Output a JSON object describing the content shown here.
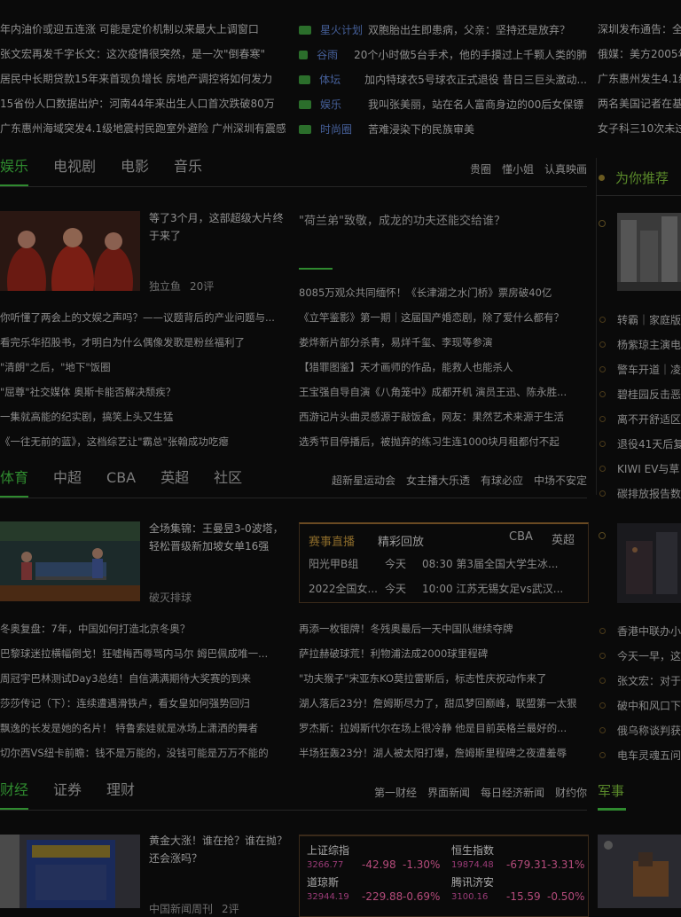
{
  "top_left_news": [
    "年内油价或迎五连涨 可能是定价机制以来最大上调窗口",
    "张文宏再发千字长文：这次疫情很突然，是一次\"倒春寒\"",
    "居民中长期贷款15年来首现负增长 房地产调控将如何发力",
    "15省份人口数据出炉：河南44年来出生人口首次跌破80万",
    "广东惠州海域突发4.1级地震村民跑室外避险 广州深圳有震感"
  ],
  "top_mid_news": [
    {
      "cat": "星火计划",
      "text": "双胞胎出生即患病，父亲：坚持还是放弃？"
    },
    {
      "cat": "谷雨",
      "text": "20个小时做5台手术，他的手摸过上千颗人类的肺"
    },
    {
      "cat": "体坛",
      "text": "加内特球衣5号球衣正式退役 昔日三巨头激动..."
    },
    {
      "cat": "娱乐",
      "text": "我叫张美丽，站在名人富商身边的00后女保镖"
    },
    {
      "cat": "时尚圈",
      "text": "苦难浸染下的民族审美"
    }
  ],
  "top_right_news": [
    "深圳发布通告：全",
    "俄媒：美方2005年",
    "广东惠州发生4.1级",
    "两名美国记者在基",
    "女子科三10次未过"
  ],
  "ent": {
    "tabs": [
      "娱乐",
      "电视剧",
      "电影",
      "音乐"
    ],
    "links": [
      "贵圈",
      "懂小姐",
      "认真映画"
    ],
    "feature_caption": "等了3个月，这部超级大片终于来了",
    "feature_source": "独立鱼",
    "feature_comments": "20评",
    "headline": "\"荷兰弟\"致敬，成龙的功夫还能交给谁？",
    "left_list": [
      "你听懂了两会上的文娱之声吗？——议题背后的产业问题与...",
      "看完乐华招股书，才明白为什么偶像发歌是粉丝福利了",
      "\"清朗\"之后，\"地下\"饭圈",
      "\"屈尊\"社交媒体 奥斯卡能否解决颓疾？",
      "一集就高能的纪实剧，搞笑上头又生猛",
      "《一往无前的蓝》，这档综艺让\"霸总\"张翰成功吃瘪"
    ],
    "right_list": [
      "8085万观众共同缅怀！《长津湖之水门桥》票房破40亿",
      "《立竿鉴影》第一期｜这届国产婚恋剧，除了爱什么都有？",
      "娄烨新片部分杀青，易烊千玺、李现等参演",
      "【猎罪图鉴】天才画师的作品，能救人也能杀人",
      "王宝强自导自演《八角笼中》成都开机 演员王迅、陈永胜...",
      "西游记片头曲灵感源于敲饭盒，网友：果然艺术来源于生活",
      "选秀节目停播后，被抛弃的练习生连1000块月租都付不起"
    ]
  },
  "sports": {
    "tabs": [
      "体育",
      "中超",
      "CBA",
      "英超",
      "社区"
    ],
    "links": [
      "超新星运动会",
      "女主播大乐透",
      "有球必应",
      "中场不安定"
    ],
    "feature_caption": "全场集锦：王曼昱3-0波塔，轻松晋级新加坡女单16强",
    "feature_source": "破灭排球",
    "box_tabs": [
      "赛事直播",
      "精彩回放"
    ],
    "box_right": [
      "CBA",
      "英超"
    ],
    "box_rows": [
      {
        "a": "阳光甲B组",
        "b": "今天",
        "c": "08:30 第3届全国大学生冰..."
      },
      {
        "a": "2022全国女...",
        "b": "今天",
        "c": "10:00 江苏无锡女足vs武汉..."
      }
    ],
    "left_list": [
      "冬奥复盘：7年，中国如何打造北京冬奥？",
      "巴黎球迷拉横幅倒戈！狂嘘梅西辱骂内马尔 姆巴佩成唯一...",
      "周冠宇巴林测试Day3总结！自信满满期待大奖赛的到来",
      "莎莎传记（下）：连续遭遇滑铁卢，看女皇如何强势回归",
      "飘逸的长发是她的名片！ 特鲁索娃就是冰场上潇洒的舞者",
      "切尔西VS纽卡前瞻：钱不是万能的，没钱可能是万万不能的"
    ],
    "right_list": [
      "再添一枚银牌！冬残奥最后一天中国队继续夺牌",
      "萨拉赫破球荒！利物浦法成2000球里程碑",
      "\"功夫猴子\"宋亚东KO莫拉雷斯后，标志性庆祝动作来了",
      "湖人落后23分！詹姆斯尽力了，甜瓜梦回巅峰，联盟第一太狠",
      "罗杰斯：拉姆斯代尔在场上很冷静 他是目前英格兰最好的...",
      "半场狂轰23分！湖人被太阳打爆，詹姆斯里程碑之夜遭羞辱"
    ]
  },
  "finance": {
    "tabs": [
      "财经",
      "证券",
      "理财"
    ],
    "links": [
      "第一财经",
      "界面新闻",
      "每日经济新闻",
      "财约你"
    ],
    "feature_caption": "黄金大涨！谁在抢？谁在抛？还会涨吗？",
    "feature_source": "中国新闻周刊",
    "feature_comments": "2评",
    "stocks": [
      {
        "name": "上证综指",
        "price": "3266.77",
        "chg": "-42.98",
        "pct": "-1.30%"
      },
      {
        "name": "恒生指数",
        "price": "19874.48",
        "chg": "-679.31",
        "pct": "-3.31%"
      },
      {
        "name": "道琼斯",
        "price": "32944.19",
        "chg": "-229.88",
        "pct": "-0.69%"
      },
      {
        "name": "腾讯济安",
        "price": "3100.16",
        "chg": "-15.59",
        "pct": "-0.50%"
      }
    ]
  },
  "sidebar": {
    "recommend_title": "为你推荐",
    "list_a": [
      "转霸｜家庭版",
      "杨紫琼主演电",
      "警车开道｜凌",
      "碧桂园反击恶",
      "离不开舒适区",
      "退役41天后复",
      "KIWI EV与草",
      "碳排放报告数"
    ],
    "list_b": [
      "香港中联办小",
      "今天一早，这",
      "张文宏：对于",
      "破中和风口下",
      "俄乌称谈判获",
      "电车灵魂五问"
    ],
    "military_title": "军事"
  },
  "colors": {
    "accent": "#2f8a2f",
    "link_blue": "#46609a",
    "down": "#b54b7b"
  }
}
